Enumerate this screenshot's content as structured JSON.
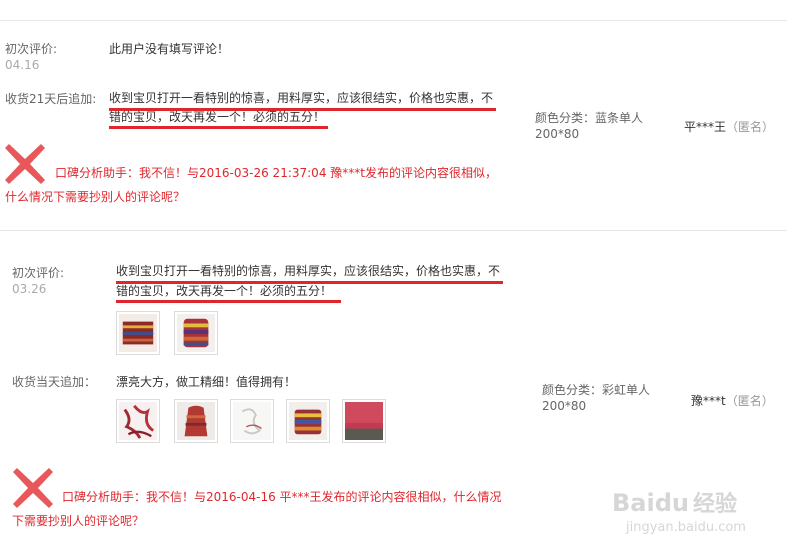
{
  "review1": {
    "initial_label": "初次评价:",
    "initial_date": "04.16",
    "initial_text": "此用户没有填写评论！",
    "append_label": "收货21天后追加:",
    "append_text_line1": "收到宝贝打开一看特别的惊喜，用料厚实，应该很结实，价格也实惠，不",
    "append_text_line2": "错的宝贝，改天再发一个！必须的五分！",
    "sku_label": "颜色分类：蓝条单人",
    "sku_size": "200*80",
    "buyer": "平***王",
    "buyer_anon": "（匿名）",
    "warning_line1": "口碑分析助手：我不信！与2016-03-26 21:37:04 豫***t发布的评论内容很相似，",
    "warning_line2": "什么情况下需要抄别人的评论呢？"
  },
  "review2": {
    "initial_label": "初次评价:",
    "initial_date": "03.26",
    "initial_text_line1": "收到宝贝打开一看特别的惊喜，用料厚实，应该很结实，价格也实惠，不",
    "initial_text_line2": "错的宝贝，改天再发一个！必须的五分！",
    "append_label": "收货当天追加：",
    "append_text": "漂亮大方，做工精细！值得拥有！",
    "sku_label": "颜色分类：彩虹单人",
    "sku_size": "200*80",
    "buyer": "豫***t",
    "buyer_anon": "（匿名）",
    "warning_line1": "口碑分析助手：我不信！与2016-04-16 平***王发布的评论内容很相似，什么情况",
    "warning_line2": "下需要抄别人的评论呢？"
  },
  "watermark": {
    "brand": "Baidu",
    "brand_suffix": "经验",
    "url": "jingyan.baidu.com"
  },
  "colors": {
    "accent_red": "#e0262c",
    "cross_red": "#e8585a"
  }
}
